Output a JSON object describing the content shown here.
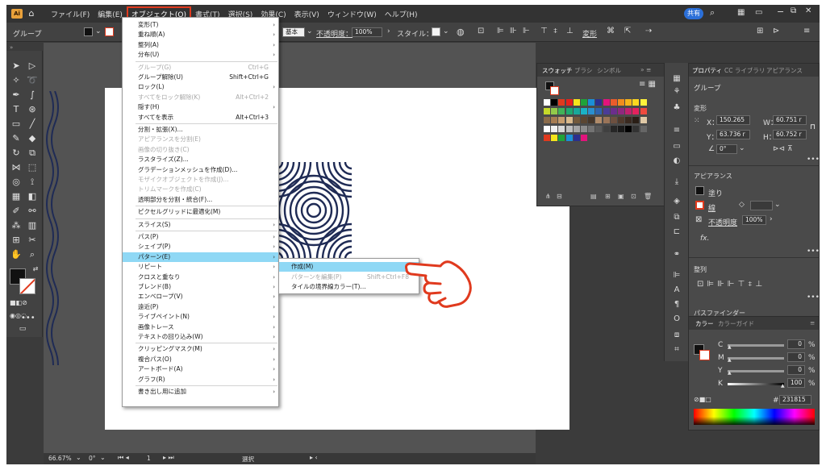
{
  "menubar": {
    "logo": "Ai",
    "items": [
      "ファイル(F)",
      "編集(E)",
      "オブジェクト(O)",
      "書式(T)",
      "選択(S)",
      "効果(C)",
      "表示(V)",
      "ウィンドウ(W)",
      "ヘルプ(H)"
    ],
    "share_label": "共有",
    "window_controls": [
      "−",
      "⧉",
      "✕"
    ]
  },
  "control_bar": {
    "selection_label": "グループ",
    "stroke_style": "基本",
    "opacity_label": "不透明度：",
    "opacity_value": "100%",
    "style_label": "スタイル：",
    "transform_label": "変形"
  },
  "object_menu": {
    "items": [
      {
        "label": "変形(T)",
        "shortcut": "",
        "submenu": true,
        "disabled": false
      },
      {
        "label": "重ね順(A)",
        "shortcut": "",
        "submenu": true,
        "disabled": false
      },
      {
        "label": "整列(A)",
        "shortcut": "",
        "submenu": true,
        "disabled": false
      },
      {
        "label": "分布(U)",
        "shortcut": "",
        "submenu": true,
        "disabled": false
      },
      {
        "sep": true
      },
      {
        "label": "グループ(G)",
        "shortcut": "Ctrl+G",
        "submenu": false,
        "disabled": true
      },
      {
        "label": "グループ解除(U)",
        "shortcut": "Shift+Ctrl+G",
        "submenu": false,
        "disabled": false
      },
      {
        "label": "ロック(L)",
        "shortcut": "",
        "submenu": true,
        "disabled": false
      },
      {
        "label": "すべてをロック解除(K)",
        "shortcut": "Alt+Ctrl+2",
        "submenu": false,
        "disabled": true
      },
      {
        "label": "隠す(H)",
        "shortcut": "",
        "submenu": true,
        "disabled": false
      },
      {
        "label": "すべてを表示",
        "shortcut": "Alt+Ctrl+3",
        "submenu": false,
        "disabled": false
      },
      {
        "sep": true
      },
      {
        "label": "分割・拡張(X)...",
        "shortcut": "",
        "submenu": false,
        "disabled": false
      },
      {
        "label": "アピアランスを分割(E)",
        "shortcut": "",
        "submenu": false,
        "disabled": true
      },
      {
        "label": "画像の切り抜き(C)",
        "shortcut": "",
        "submenu": false,
        "disabled": true
      },
      {
        "label": "ラスタライズ(Z)...",
        "shortcut": "",
        "submenu": false,
        "disabled": false
      },
      {
        "label": "グラデーションメッシュを作成(D)...",
        "shortcut": "",
        "submenu": false,
        "disabled": false
      },
      {
        "label": "モザイクオブジェクトを作成(J)...",
        "shortcut": "",
        "submenu": false,
        "disabled": true
      },
      {
        "label": "トリムマークを作成(C)",
        "shortcut": "",
        "submenu": false,
        "disabled": true
      },
      {
        "label": "透明部分を分割・統合(F)...",
        "shortcut": "",
        "submenu": false,
        "disabled": false
      },
      {
        "sep": true
      },
      {
        "label": "ピクセルグリッドに最適化(M)",
        "shortcut": "",
        "submenu": false,
        "disabled": false
      },
      {
        "sep": true
      },
      {
        "label": "スライス(S)",
        "shortcut": "",
        "submenu": true,
        "disabled": false
      },
      {
        "sep": true
      },
      {
        "label": "パス(P)",
        "shortcut": "",
        "submenu": true,
        "disabled": false
      },
      {
        "label": "シェイプ(P)",
        "shortcut": "",
        "submenu": true,
        "disabled": false
      },
      {
        "label": "パターン(E)",
        "shortcut": "",
        "submenu": true,
        "disabled": false,
        "highlight": true
      },
      {
        "label": "リピート",
        "shortcut": "",
        "submenu": true,
        "disabled": false
      },
      {
        "label": "クロスと重なり",
        "shortcut": "",
        "submenu": true,
        "disabled": false
      },
      {
        "label": "ブレンド(B)",
        "shortcut": "",
        "submenu": true,
        "disabled": false
      },
      {
        "label": "エンベロープ(V)",
        "shortcut": "",
        "submenu": true,
        "disabled": false
      },
      {
        "label": "遠近(P)",
        "shortcut": "",
        "submenu": true,
        "disabled": false
      },
      {
        "label": "ライブペイント(N)",
        "shortcut": "",
        "submenu": true,
        "disabled": false
      },
      {
        "label": "画像トレース",
        "shortcut": "",
        "submenu": true,
        "disabled": false
      },
      {
        "label": "テキストの回り込み(W)",
        "shortcut": "",
        "submenu": true,
        "disabled": false
      },
      {
        "sep": true
      },
      {
        "label": "クリッピングマスク(M)",
        "shortcut": "",
        "submenu": true,
        "disabled": false
      },
      {
        "label": "複合パス(O)",
        "shortcut": "",
        "submenu": true,
        "disabled": false
      },
      {
        "label": "アートボード(A)",
        "shortcut": "",
        "submenu": true,
        "disabled": false
      },
      {
        "label": "グラフ(R)",
        "shortcut": "",
        "submenu": true,
        "disabled": false
      },
      {
        "sep": true
      },
      {
        "label": "書き出し用に追加",
        "shortcut": "",
        "submenu": true,
        "disabled": false
      }
    ]
  },
  "pattern_submenu": {
    "items": [
      {
        "label": "作成(M)",
        "shortcut": "",
        "highlight": true,
        "disabled": false
      },
      {
        "label": "パターンを編集(P)",
        "shortcut": "Shift+Ctrl+F8",
        "highlight": false,
        "disabled": true
      },
      {
        "label": "タイルの境界線カラー(T)...",
        "shortcut": "",
        "highlight": false,
        "disabled": false
      }
    ]
  },
  "swatches_panel": {
    "tabs": [
      "スウォッチ",
      "ブラシ",
      "シンボル"
    ]
  },
  "properties_panel": {
    "tabs": [
      "プロパティ",
      "CC ライブラリ",
      "アピアランス"
    ],
    "selection": "グループ",
    "transform_title": "変形",
    "x_label": "X：",
    "x_value": "150.265",
    "y_label": "Y：",
    "y_value": "63.736 r",
    "w_label": "W：",
    "w_value": "60.751 r",
    "h_label": "H：",
    "h_value": "60.752 r",
    "angle_value": "0°",
    "appearance_title": "アピアランス",
    "fill_label": "塗り",
    "stroke_label": "線",
    "opacity_label": "不透明度",
    "opacity_value": "100%",
    "fx_label": "fx.",
    "align_title": "整列",
    "pathfinder_title": "パスファインダー"
  },
  "color_panel": {
    "tabs": [
      "カラー",
      "カラーガイド"
    ],
    "channels": [
      {
        "label": "C",
        "value": "0",
        "unit": "%",
        "level": 0
      },
      {
        "label": "M",
        "value": "0",
        "unit": "%",
        "level": 0
      },
      {
        "label": "Y",
        "value": "0",
        "unit": "%",
        "level": 0
      },
      {
        "label": "K",
        "value": "100",
        "unit": "%",
        "level": 1
      }
    ],
    "hex_label": "#",
    "hex_value": "231815"
  },
  "status_bar": {
    "zoom": "66.67%",
    "rotation": "0°",
    "artboard": "1",
    "tool": "選択"
  },
  "colors": {
    "accent_red": "#e03a1e",
    "menu_highlight": "#8fd8f5",
    "pattern_ink": "#1f2b55"
  }
}
